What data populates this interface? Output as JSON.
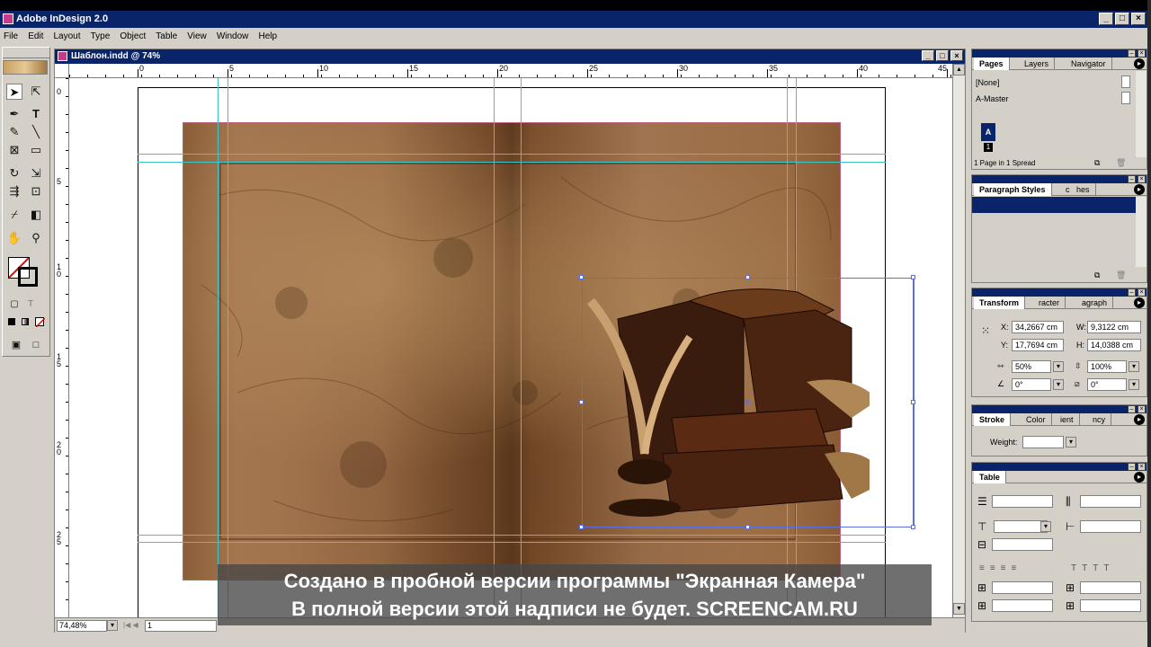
{
  "app": {
    "title": "Adobe InDesign 2.0"
  },
  "menu": [
    "File",
    "Edit",
    "Layout",
    "Type",
    "Object",
    "Table",
    "View",
    "Window",
    "Help"
  ],
  "document": {
    "title": "Шаблон.indd @ 74%",
    "zoom": "74,48%",
    "page": "1",
    "ruler_h": [
      "0",
      "5",
      "10",
      "15",
      "20",
      "25",
      "30",
      "35",
      "40",
      "45"
    ],
    "ruler_v": [
      "0",
      "5",
      "1\n0",
      "1\n5",
      "2\n0",
      "2\n5"
    ]
  },
  "pages_panel": {
    "tabs": [
      "Pages",
      "Layers",
      "Navigator"
    ],
    "items": [
      "[None]",
      "A-Master"
    ],
    "master_label": "A",
    "page_label": "1",
    "footer": "1 Page in 1 Spread"
  },
  "paragraph_panel": {
    "tabs": [
      "Paragraph Styles",
      "Character Styles"
    ],
    "tab2_visible": "c   hes"
  },
  "transform_panel": {
    "tabs": [
      "Transform",
      "Character",
      "Paragraph"
    ],
    "tab2_visible": "racter",
    "tab3_visible": "agraph",
    "x": "34,2667 cm",
    "y": "17,7694 cm",
    "w": "9,3122 cm",
    "h": "14,0388 cm",
    "scale_x": "50%",
    "scale_y": "100%",
    "rotate": "0°",
    "shear": "0°",
    "x_label": "X:",
    "y_label": "Y:",
    "w_label": "W:",
    "h_label": "H:"
  },
  "stroke_panel": {
    "tabs": [
      "Stroke",
      "Color",
      "Gradient",
      "Transparency"
    ],
    "tab2_visible": "Color",
    "tab3_visible": "ient",
    "tab4_visible": "ncy",
    "weight_label": "Weight:"
  },
  "table_panel": {
    "title": "Table"
  },
  "watermark": {
    "line1": "Создано в пробной версии программы \"Экранная Камера\"",
    "line2": "В полной версии этой надписи не будет. SCREENCAM.RU"
  },
  "colors": {
    "titlebar": "#0a246a",
    "chrome": "#d4d0c8",
    "guide": "#3cc8c8",
    "selection": "#5a6ee0"
  }
}
